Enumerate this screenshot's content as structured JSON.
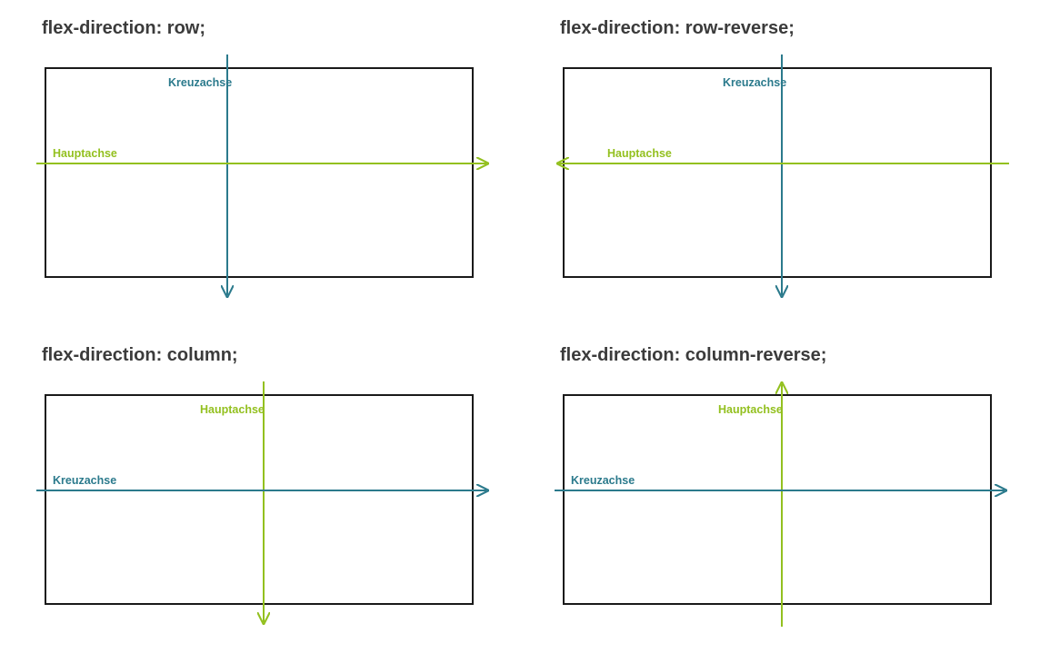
{
  "colors": {
    "main": "#93c01f",
    "cross": "#2b7a8c",
    "border": "#1a1a1a"
  },
  "labels": {
    "main_axis": "Hauptachse",
    "cross_axis": "Kreuzachse"
  },
  "panels": {
    "row": {
      "title": "flex-direction: row;"
    },
    "row_reverse": {
      "title": "flex-direction: row-reverse;"
    },
    "column": {
      "title": "flex-direction: column;"
    },
    "column_reverse": {
      "title": "flex-direction: column-reverse;"
    }
  },
  "chart_data": [
    {
      "id": "row",
      "title": "flex-direction: row;",
      "main_axis": {
        "label": "Hauptachse",
        "orientation": "horizontal",
        "direction": "right",
        "color": "#93c01f"
      },
      "cross_axis": {
        "label": "Kreuzachse",
        "orientation": "vertical",
        "direction": "down",
        "color": "#2b7a8c"
      },
      "vertical_axis_x_fraction": 0.42
    },
    {
      "id": "row_reverse",
      "title": "flex-direction: row-reverse;",
      "main_axis": {
        "label": "Hauptachse",
        "orientation": "horizontal",
        "direction": "left",
        "color": "#93c01f"
      },
      "cross_axis": {
        "label": "Kreuzachse",
        "orientation": "vertical",
        "direction": "down",
        "color": "#2b7a8c"
      },
      "vertical_axis_x_fraction": 0.5
    },
    {
      "id": "column",
      "title": "flex-direction: column;",
      "main_axis": {
        "label": "Hauptachse",
        "orientation": "vertical",
        "direction": "down",
        "color": "#93c01f"
      },
      "cross_axis": {
        "label": "Kreuzachse",
        "orientation": "horizontal",
        "direction": "right",
        "color": "#2b7a8c"
      },
      "vertical_axis_x_fraction": 0.5
    },
    {
      "id": "column_reverse",
      "title": "flex-direction: column-reverse;",
      "main_axis": {
        "label": "Hauptachse",
        "orientation": "vertical",
        "direction": "up",
        "color": "#93c01f"
      },
      "cross_axis": {
        "label": "Kreuzachse",
        "orientation": "horizontal",
        "direction": "right",
        "color": "#2b7a8c"
      },
      "vertical_axis_x_fraction": 0.5
    }
  ]
}
